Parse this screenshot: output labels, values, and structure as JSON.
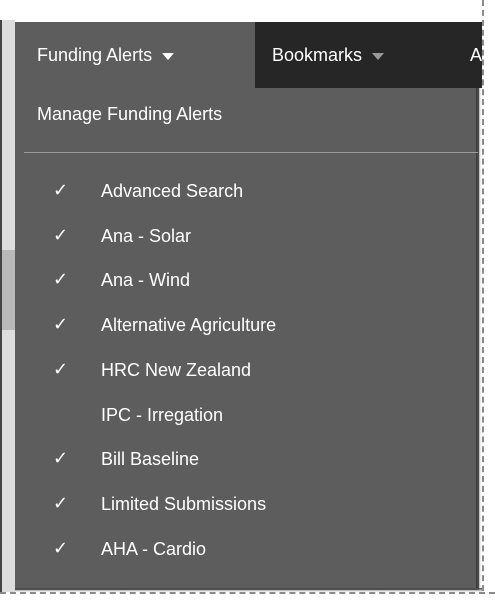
{
  "nav": {
    "funding_alerts_label": "Funding Alerts",
    "bookmarks_label": "Bookmarks",
    "third_label": "A"
  },
  "menu": {
    "manage_label": "Manage Funding Alerts",
    "check_glyph": "✓",
    "items": [
      {
        "label": "Advanced Search",
        "checked": true
      },
      {
        "label": "Ana - Solar",
        "checked": true
      },
      {
        "label": "Ana - Wind",
        "checked": true
      },
      {
        "label": "Alternative Agriculture",
        "checked": true
      },
      {
        "label": "HRC New Zealand",
        "checked": true
      },
      {
        "label": "IPC - Irregation",
        "checked": false
      },
      {
        "label": "Bill Baseline",
        "checked": true
      },
      {
        "label": "Limited Submissions",
        "checked": true
      },
      {
        "label": "AHA - Cardio",
        "checked": true
      }
    ]
  },
  "colors": {
    "navbar": "#262626",
    "menu": "#5d5d5d",
    "text": "#ffffff",
    "divider": "#9a9a9a"
  },
  "icons": {
    "caret": "chevron-down-icon",
    "check": "checkmark-icon"
  }
}
